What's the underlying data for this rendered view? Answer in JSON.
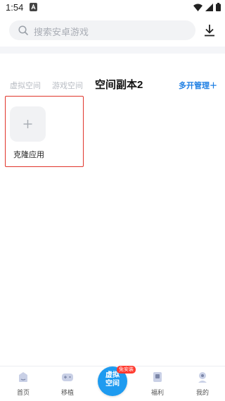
{
  "status_bar": {
    "time": "1:54"
  },
  "search": {
    "placeholder": "搜索安卓游戏"
  },
  "tabs": [
    {
      "label": "虚拟空间",
      "active": false
    },
    {
      "label": "游戏空间",
      "active": false
    },
    {
      "label": "空间副本2",
      "active": true
    }
  ],
  "manage": {
    "label": "多开管理＋"
  },
  "clone": {
    "label": "克隆应用"
  },
  "bottom_nav": {
    "home": "首页",
    "migrate": "移植",
    "center_line1": "虚拟",
    "center_line2": "空间",
    "center_badge": "免安装",
    "welfare": "福利",
    "mine": "我的"
  },
  "colors": {
    "accent": "#1f7fe3",
    "highlight_border": "#e0352b",
    "center_button": "#1e9bf0",
    "badge": "#ff3b30"
  }
}
